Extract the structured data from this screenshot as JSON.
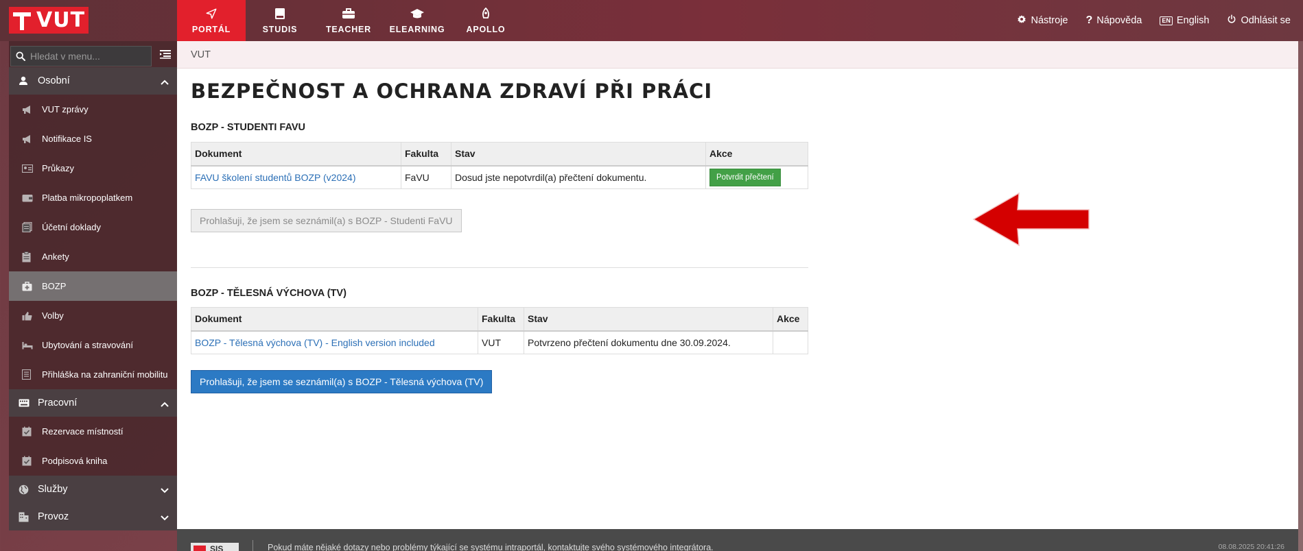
{
  "logo": {
    "text": "VUT"
  },
  "topnav": [
    {
      "label": "PORTÁL",
      "icon": "paper-plane-icon",
      "active": true
    },
    {
      "label": "STUDIS",
      "icon": "book-icon"
    },
    {
      "label": "TEACHER",
      "icon": "briefcase-icon"
    },
    {
      "label": "ELEARNING",
      "icon": "graduation-cap-icon"
    },
    {
      "label": "APOLLO",
      "icon": "rocket-icon"
    }
  ],
  "topright": {
    "tools": "Nástroje",
    "help": "Nápověda",
    "lang_badge": "EN",
    "lang": "English",
    "logout": "Odhlásit se"
  },
  "search": {
    "placeholder": "Hledat v menu..."
  },
  "sidebar": {
    "sections": [
      {
        "label": "Osobní",
        "icon": "person-icon",
        "open": true
      },
      {
        "label": "Pracovní",
        "icon": "keyboard-icon",
        "open": true
      },
      {
        "label": "Služby",
        "icon": "globe-icon",
        "open": false
      },
      {
        "label": "Provoz",
        "icon": "building-icon",
        "open": false
      }
    ],
    "osobni_items": [
      {
        "label": "VUT zprávy",
        "icon": "megaphone-icon"
      },
      {
        "label": "Notifikace IS",
        "icon": "megaphone-icon"
      },
      {
        "label": "Průkazy",
        "icon": "id-card-icon"
      },
      {
        "label": "Platba mikropoplatkem",
        "icon": "wallet-icon"
      },
      {
        "label": "Účetní doklady",
        "icon": "receipts-icon"
      },
      {
        "label": "Ankety",
        "icon": "clipboard-icon"
      },
      {
        "label": "BOZP",
        "icon": "first-aid-icon",
        "active": true
      },
      {
        "label": "Volby",
        "icon": "thumbs-up-icon"
      },
      {
        "label": "Ubytování a stravování",
        "icon": "bed-icon"
      },
      {
        "label": "Přihláška na zahraniční mobilitu",
        "icon": "document-icon"
      }
    ],
    "pracovni_items": [
      {
        "label": "Rezervace místností",
        "icon": "calendar-check-icon"
      },
      {
        "label": "Podpisová kniha",
        "icon": "calendar-check-icon"
      }
    ]
  },
  "breadcrumb": "VUT",
  "page_title": "BEZPEČNOST A OCHRANA ZDRAVÍ PŘI PRÁCI",
  "section1": {
    "title": "BOZP - STUDENTI FAVU",
    "headers": [
      "Dokument",
      "Fakulta",
      "Stav",
      "Akce"
    ],
    "row": {
      "document": "FAVU školení studentů BOZP (v2024)",
      "faculty": "FaVU",
      "status": "Dosud jste nepotvrdil(a) přečtení dokumentu.",
      "action": "Potvrdit přečtení"
    },
    "declare_button": "Prohlašuji, že jsem se seznámil(a) s BOZP - Studenti FaVU"
  },
  "section2": {
    "title": "BOZP - TĚLESNÁ VÝCHOVA (TV)",
    "headers": [
      "Dokument",
      "Fakulta",
      "Stav",
      "Akce"
    ],
    "row": {
      "document": "BOZP - Tělesná výchova (TV) - English version included",
      "faculty": "VUT",
      "status": "Potvrzeno přečtení dokumentu dne 30.09.2024.",
      "action": ""
    },
    "declare_button": "Prohlašuji, že jsem se seznámil(a) s BOZP - Tělesná výchova (TV)"
  },
  "footer": {
    "logo_text": "SIS",
    "text": "Pokud máte nějaké dotazy nebo problémy týkající se systému intraportál, kontaktujte svého systémového integrátora.",
    "timestamp": "08.08.2025 20:41:26"
  },
  "colors": {
    "accent_red": "#e2202c",
    "link_blue": "#2b6fb6",
    "green_button": "#43a047",
    "blue_button": "#2c7ac4",
    "annotation_arrow": "#d40000"
  }
}
